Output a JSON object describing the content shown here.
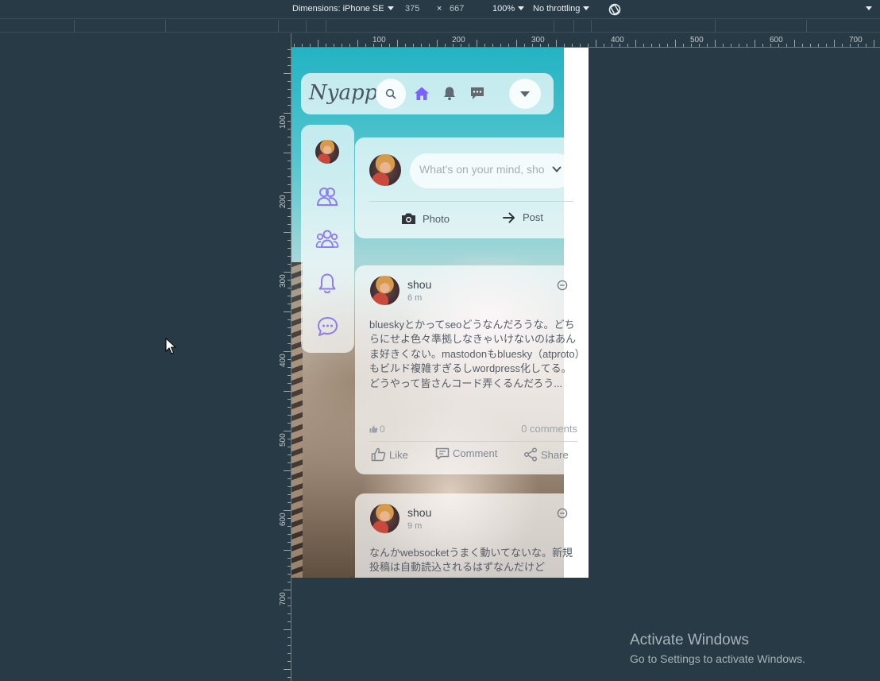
{
  "devtools": {
    "dimensions_label": "Dimensions: iPhone SE",
    "width": "375",
    "times": "×",
    "height": "667",
    "zoom": "100%",
    "throttling": "No throttling"
  },
  "ruler": {
    "h_labels": [
      "100",
      "200",
      "300",
      "400",
      "500",
      "600",
      "700"
    ],
    "v_labels": [
      "100",
      "200",
      "300",
      "400",
      "500",
      "600",
      "700"
    ]
  },
  "app": {
    "logo": "Nyapp",
    "composer": {
      "placeholder": "What's on your mind, sho",
      "photo_label": "Photo",
      "post_label": "Post"
    },
    "posts": [
      {
        "author": "shou",
        "time": "6 m",
        "body": "blueskyとかってseoどうなんだろうな。どちらにせよ色々準拠しなきゃいけないのはあんま好きくない。mastodonもbluesky（atproto）もビルド複雑すぎるしwordpress化してる。どうやって皆さんコード弄くるんだろう...",
        "likes": "0",
        "comments": "0 comments",
        "like_label": "Like",
        "comment_label": "Comment",
        "share_label": "Share"
      },
      {
        "author": "shou",
        "time": "9 m",
        "body": "なんかwebsocketうまく動いてないな。新規投稿は自動読込されるはずなんだけど"
      }
    ]
  },
  "watermark": {
    "title": "Activate Windows",
    "subtitle": "Go to Settings to activate Windows."
  },
  "colors": {
    "accent": "#7b61ff",
    "devtools_bg": "#283a45",
    "sidebar_icon": "#8e7cf0"
  }
}
